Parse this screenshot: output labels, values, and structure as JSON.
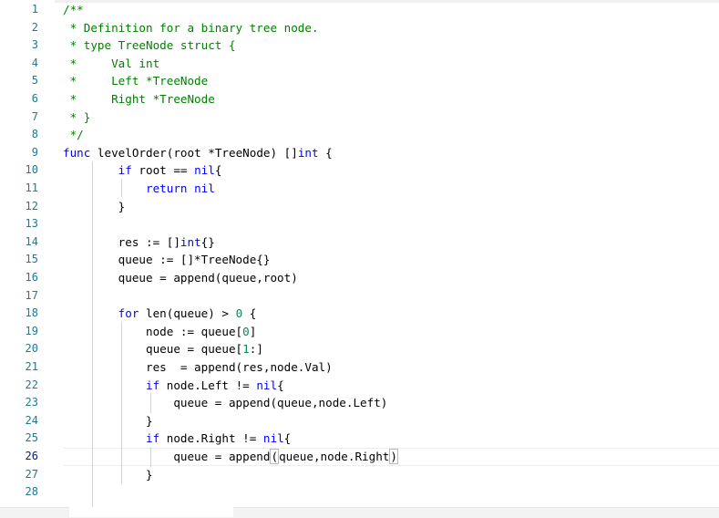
{
  "editor": {
    "active_line": 26,
    "lines": [
      {
        "n": "1",
        "segments": [
          {
            "t": "/**",
            "k": "comment"
          }
        ]
      },
      {
        "n": "2",
        "segments": [
          {
            "t": " * Definition for a binary tree node.",
            "k": "comment"
          }
        ]
      },
      {
        "n": "3",
        "segments": [
          {
            "t": " * type TreeNode struct {",
            "k": "comment"
          }
        ]
      },
      {
        "n": "4",
        "segments": [
          {
            "t": " *     Val int",
            "k": "comment"
          }
        ]
      },
      {
        "n": "5",
        "segments": [
          {
            "t": " *     Left *TreeNode",
            "k": "comment"
          }
        ]
      },
      {
        "n": "6",
        "segments": [
          {
            "t": " *     Right *TreeNode",
            "k": "comment"
          }
        ]
      },
      {
        "n": "7",
        "segments": [
          {
            "t": " * }",
            "k": "comment"
          }
        ]
      },
      {
        "n": "8",
        "segments": [
          {
            "t": " */",
            "k": "comment"
          }
        ]
      },
      {
        "n": "9",
        "segments": [
          {
            "t": "func",
            "k": "kw"
          },
          {
            "t": " levelOrder(root *TreeNode) []",
            "k": ""
          },
          {
            "t": "int",
            "k": "kw"
          },
          {
            "t": " {",
            "k": ""
          }
        ]
      },
      {
        "n": "10",
        "segments": [
          {
            "t": "        ",
            "k": ""
          },
          {
            "t": "if",
            "k": "kw"
          },
          {
            "t": " root == ",
            "k": ""
          },
          {
            "t": "nil",
            "k": "kw"
          },
          {
            "t": "{",
            "k": ""
          }
        ]
      },
      {
        "n": "11",
        "segments": [
          {
            "t": "            ",
            "k": ""
          },
          {
            "t": "return",
            "k": "kw"
          },
          {
            "t": " ",
            "k": ""
          },
          {
            "t": "nil",
            "k": "kw"
          }
        ]
      },
      {
        "n": "12",
        "segments": [
          {
            "t": "        }",
            "k": ""
          }
        ]
      },
      {
        "n": "13",
        "segments": [
          {
            "t": "",
            "k": ""
          }
        ]
      },
      {
        "n": "14",
        "segments": [
          {
            "t": "        res := []",
            "k": ""
          },
          {
            "t": "int",
            "k": "kw"
          },
          {
            "t": "{}",
            "k": ""
          }
        ]
      },
      {
        "n": "15",
        "segments": [
          {
            "t": "        queue := []*TreeNode{}",
            "k": ""
          }
        ]
      },
      {
        "n": "16",
        "segments": [
          {
            "t": "        queue = append(queue,root)",
            "k": ""
          }
        ]
      },
      {
        "n": "17",
        "segments": [
          {
            "t": "",
            "k": ""
          }
        ]
      },
      {
        "n": "18",
        "segments": [
          {
            "t": "        ",
            "k": ""
          },
          {
            "t": "for",
            "k": "kw"
          },
          {
            "t": " len(queue) > ",
            "k": ""
          },
          {
            "t": "0",
            "k": "num"
          },
          {
            "t": " {",
            "k": ""
          }
        ]
      },
      {
        "n": "19",
        "segments": [
          {
            "t": "            node := queue[",
            "k": ""
          },
          {
            "t": "0",
            "k": "num"
          },
          {
            "t": "]",
            "k": ""
          }
        ]
      },
      {
        "n": "20",
        "segments": [
          {
            "t": "            queue = queue[",
            "k": ""
          },
          {
            "t": "1",
            "k": "num"
          },
          {
            "t": ":]",
            "k": ""
          }
        ]
      },
      {
        "n": "21",
        "segments": [
          {
            "t": "            res  = append(res,node.Val)",
            "k": ""
          }
        ]
      },
      {
        "n": "22",
        "segments": [
          {
            "t": "            ",
            "k": ""
          },
          {
            "t": "if",
            "k": "kw"
          },
          {
            "t": " node.Left != ",
            "k": ""
          },
          {
            "t": "nil",
            "k": "kw"
          },
          {
            "t": "{",
            "k": ""
          }
        ]
      },
      {
        "n": "23",
        "segments": [
          {
            "t": "                queue = append(queue,node.Left)",
            "k": ""
          }
        ]
      },
      {
        "n": "24",
        "segments": [
          {
            "t": "            }",
            "k": ""
          }
        ]
      },
      {
        "n": "25",
        "segments": [
          {
            "t": "            ",
            "k": ""
          },
          {
            "t": "if",
            "k": "kw"
          },
          {
            "t": " node.Right != ",
            "k": ""
          },
          {
            "t": "nil",
            "k": "kw"
          },
          {
            "t": "{",
            "k": ""
          }
        ]
      },
      {
        "n": "26",
        "segments": [
          {
            "t": "                queue = append",
            "k": ""
          },
          {
            "t": "(",
            "k": "bracket"
          },
          {
            "t": "queue,node.Right",
            "k": ""
          },
          {
            "t": ")",
            "k": "bracket"
          }
        ]
      },
      {
        "n": "27",
        "segments": [
          {
            "t": "            }",
            "k": ""
          }
        ]
      },
      {
        "n": "28",
        "segments": [
          {
            "t": "",
            "k": ""
          }
        ]
      }
    ]
  }
}
